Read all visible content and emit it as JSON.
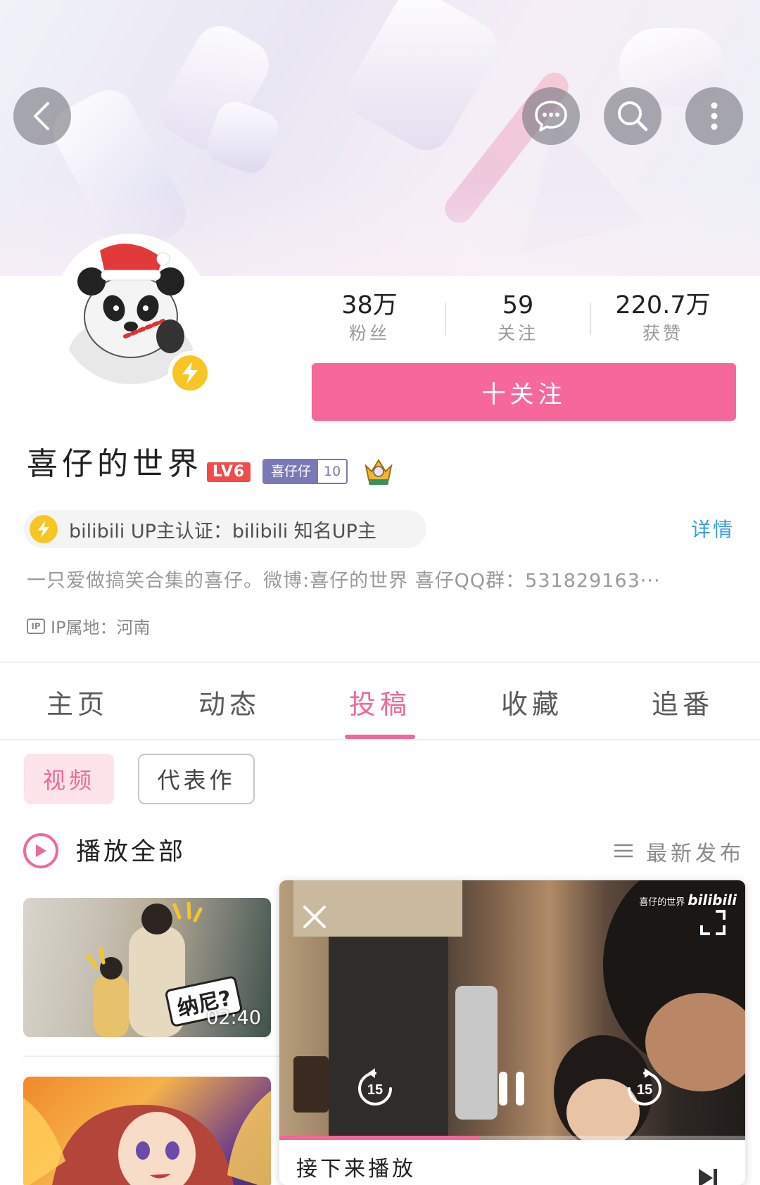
{
  "header": {
    "back_icon": "chevron-left-icon",
    "actions": [
      "message-icon",
      "search-icon",
      "more-vertical-icon"
    ]
  },
  "profile": {
    "username": "喜仔的世界",
    "level": "LV6",
    "fan_medal": {
      "name": "喜仔仔",
      "level": "10"
    },
    "stats": [
      {
        "value": "38万",
        "label": "粉丝"
      },
      {
        "value": "59",
        "label": "关注"
      },
      {
        "value": "220.7万",
        "label": "获赞"
      }
    ],
    "follow_label": "十关注",
    "certification": "bilibili UP主认证：bilibili 知名UP主",
    "detail_label": "详情",
    "bio": "一只爱做搞笑合集的喜仔。微博:喜仔的世界 喜仔QQ群：531829163···",
    "ip_badge": "IP",
    "ip_location": "IP属地：河南"
  },
  "tabs": [
    {
      "label": "主页",
      "active": false
    },
    {
      "label": "动态",
      "active": false
    },
    {
      "label": "投稿",
      "active": true
    },
    {
      "label": "收藏",
      "active": false
    },
    {
      "label": "追番",
      "active": false
    }
  ],
  "filters": {
    "video": "视频",
    "representative": "代表作"
  },
  "list_header": {
    "play_all": "播放全部",
    "sort": "最新发布"
  },
  "videos": [
    {
      "duration": "02:40",
      "sticker": "纳尼?"
    },
    {
      "duration": ""
    }
  ],
  "mini_player": {
    "watermark_name": "喜仔的世界",
    "watermark_logo": "bilibili",
    "rewind_seconds": "15",
    "forward_seconds": "15",
    "progress": 0.43,
    "next_label": "接下来播放"
  },
  "colors": {
    "accent_pink": "#f7689a",
    "tab_active": "#ef6a97",
    "link_blue": "#3a9fd6",
    "cert_yellow": "#f7c624",
    "level_red": "#f04c49",
    "medal_purple": "#7b79b5"
  }
}
